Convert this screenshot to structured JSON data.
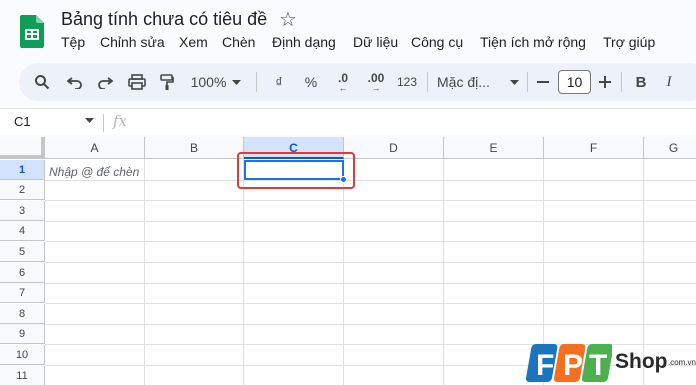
{
  "app": {
    "title": "Bảng tính chưa có tiêu đề",
    "brand_color": "#0f9d58"
  },
  "menu": [
    {
      "label": "Tệp"
    },
    {
      "label": "Chỉnh sửa"
    },
    {
      "label": "Xem"
    },
    {
      "label": "Chèn"
    },
    {
      "label": "Định dạng"
    },
    {
      "label": "Dữ liệu"
    },
    {
      "label": "Công cụ"
    },
    {
      "label": "Tiện ích mở rộng"
    },
    {
      "label": "Trợ giúp"
    }
  ],
  "toolbar": {
    "zoom": "100%",
    "currency": "₫",
    "percent": "%",
    "decrease_decimal": ".0",
    "increase_decimal": ".00",
    "number_format": "123",
    "font_family": "Mặc đị...",
    "font_size": "10",
    "bold": "B",
    "italic": "I",
    "icons": [
      "search-icon",
      "undo-icon",
      "redo-icon",
      "print-icon",
      "paint-format-icon",
      "decrease-font-icon",
      "increase-font-icon"
    ]
  },
  "formula_bar": {
    "cell_ref": "C1",
    "fx": "fx",
    "value": ""
  },
  "grid": {
    "columns": [
      "A",
      "B",
      "C",
      "D",
      "E",
      "F",
      "G"
    ],
    "rows": [
      "1",
      "2",
      "3",
      "4",
      "5",
      "6",
      "7",
      "8",
      "9",
      "10",
      "11"
    ],
    "active_column": "C",
    "active_row": "1",
    "cell_hint": "Nhập @ để chèn",
    "selection_color": "#1a73e8",
    "highlight_color": "#e53935"
  },
  "watermark": {
    "brand": "FPT",
    "shop": "Shop",
    "domain": ".com.vn"
  }
}
